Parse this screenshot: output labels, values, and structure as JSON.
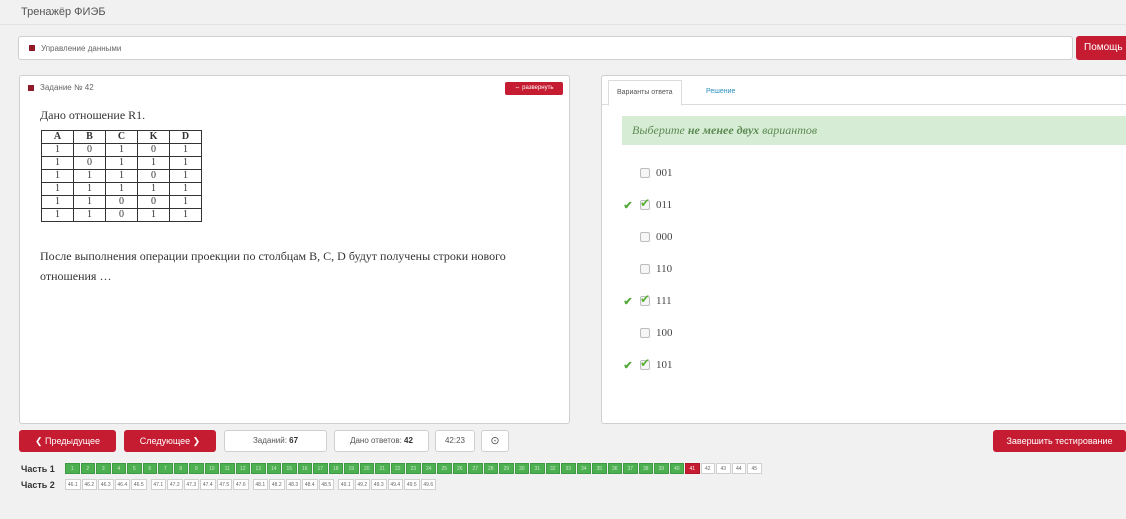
{
  "app": {
    "title": "Тренажёр ФИЭБ"
  },
  "section": {
    "label": "Управление данными",
    "help_label": "Помощь"
  },
  "task": {
    "title": "Задание № 42",
    "expand_label": "⇔ развернуть",
    "intro": "Дано отношение R1.",
    "question": "После выполнения операции проекции по столбцам B, C, D будут получены строки нового отношения …",
    "table": {
      "headers": [
        "A",
        "B",
        "C",
        "K",
        "D"
      ],
      "rows": [
        [
          "1",
          "0",
          "1",
          "0",
          "1"
        ],
        [
          "1",
          "0",
          "1",
          "1",
          "1"
        ],
        [
          "1",
          "1",
          "1",
          "0",
          "1"
        ],
        [
          "1",
          "1",
          "1",
          "1",
          "1"
        ],
        [
          "1",
          "1",
          "0",
          "0",
          "1"
        ],
        [
          "1",
          "1",
          "0",
          "1",
          "1"
        ]
      ]
    }
  },
  "answers": {
    "tab_active": "Варианты ответа",
    "tab_other": "Решение",
    "instruction_pre": "Выберите ",
    "instruction_bold": "не менее двух",
    "instruction_post": " вариантов",
    "options": [
      {
        "label": "001",
        "checked": false,
        "correct": false
      },
      {
        "label": "011",
        "checked": true,
        "correct": true
      },
      {
        "label": "000",
        "checked": false,
        "correct": false
      },
      {
        "label": "110",
        "checked": false,
        "correct": false
      },
      {
        "label": "111",
        "checked": true,
        "correct": true
      },
      {
        "label": "100",
        "checked": false,
        "correct": false
      },
      {
        "label": "101",
        "checked": true,
        "correct": true
      }
    ]
  },
  "nav": {
    "prev_label": "❮ Предыдущее",
    "next_label": "Следующее ❯",
    "tasks_label": "Заданий:",
    "tasks_value": "67",
    "answered_label": "Дано ответов:",
    "answered_value": "42",
    "timer": "42:23",
    "finish_label": "Завершить тестирование",
    "settings_icon": "circle-gear-icon"
  },
  "parts": {
    "part1": {
      "label": "Часть 1",
      "items": [
        "1",
        "2",
        "3",
        "4",
        "5",
        "6",
        "7",
        "8",
        "9",
        "10",
        "11",
        "12",
        "13",
        "14",
        "15",
        "16",
        "17",
        "18",
        "19",
        "20",
        "21",
        "22",
        "23",
        "24",
        "25",
        "26",
        "27",
        "28",
        "29",
        "30",
        "31",
        "32",
        "33",
        "34",
        "35",
        "36",
        "37",
        "38",
        "39",
        "40",
        "41",
        "42",
        "43",
        "44",
        "45"
      ],
      "done_count": 40,
      "current": "41"
    },
    "part2": {
      "label": "Часть 2",
      "groups": [
        [
          "46.1",
          "46.2",
          "46.3",
          "46.4",
          "46.5"
        ],
        [
          "47.1",
          "47.2",
          "47.3",
          "47.4",
          "47.5",
          "47.6"
        ],
        [
          "48.1",
          "48.2",
          "48.3",
          "48.4",
          "48.5"
        ],
        [
          "49.1",
          "49.2",
          "49.3",
          "49.4",
          "49.5",
          "49.6"
        ]
      ]
    }
  },
  "colors": {
    "accent_red": "#c51c32",
    "done_green": "#4caf50",
    "instruction_bg": "#d7ecd4"
  }
}
